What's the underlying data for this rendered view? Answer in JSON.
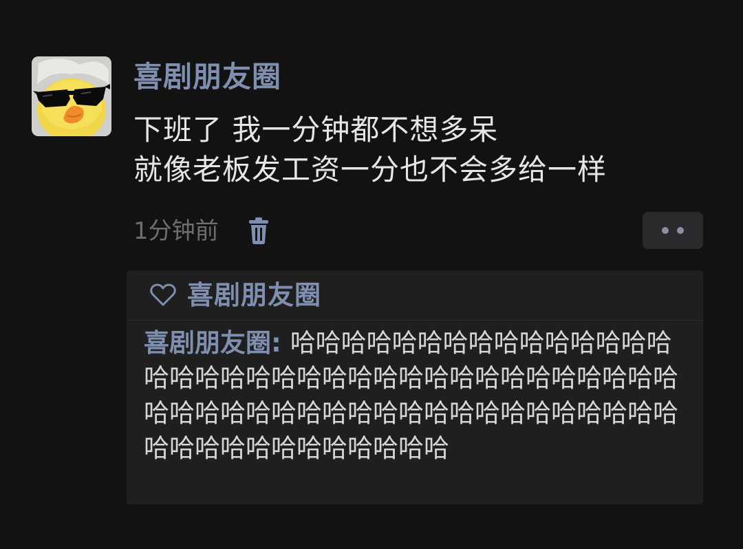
{
  "post": {
    "username": "喜剧朋友圈",
    "content_lines": [
      "下班了 我一分钟都不想多呆",
      "就像老板发工资一分也不会多给一样"
    ],
    "time": "1分钟前",
    "icons": {
      "delete": "trash-icon",
      "more": "more-dots-icon",
      "like": "heart-icon"
    }
  },
  "interactions": {
    "likes": [
      "喜剧朋友圈"
    ],
    "comments": [
      {
        "author": "喜剧朋友圈",
        "separator": ": ",
        "text": "哈哈哈哈哈哈哈哈哈哈哈哈哈哈哈哈哈哈哈哈哈哈哈哈哈哈哈哈哈哈哈哈哈哈哈哈哈哈哈哈哈哈哈哈哈哈哈哈哈哈哈哈哈哈哈哈哈哈哈哈哈哈哈哈哈哈哈哈哈"
      }
    ]
  },
  "colors": {
    "background": "#121212",
    "name": "#7f8fb0",
    "text": "#e6e6e6",
    "muted": "#6e6e6e",
    "panel": "#1f1f20"
  }
}
